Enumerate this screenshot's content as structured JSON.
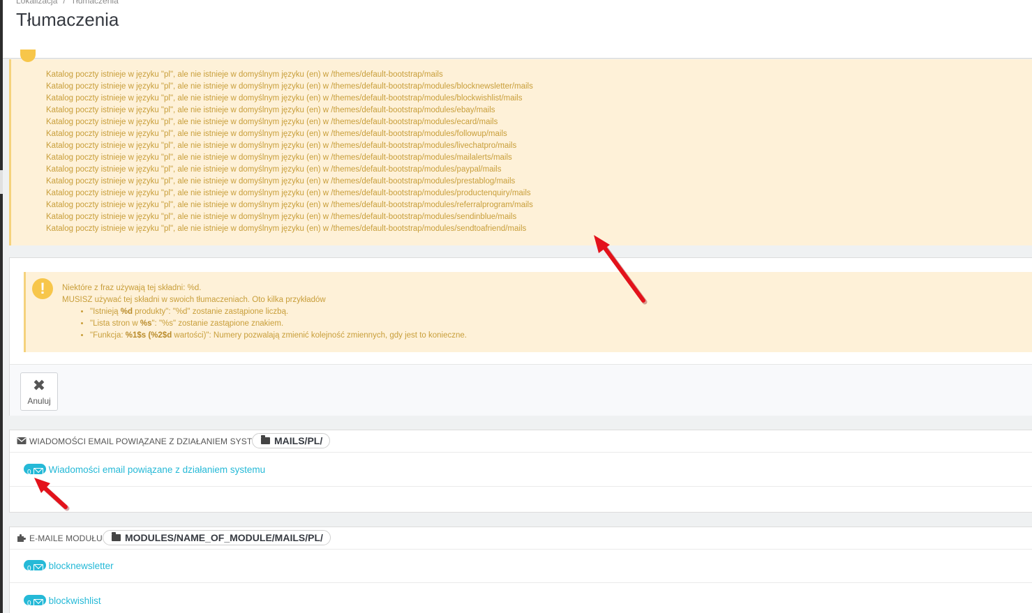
{
  "breadcrumb": {
    "parent": "Lokalizacja",
    "separator": "/",
    "current": "Tłumaczenia"
  },
  "page_title": "Tłumaczenia",
  "warnings": [
    "Katalog poczty istnieje w języku \"pl\", ale nie istnieje w domyślnym języku (en) w /themes/default-bootstrap/mails",
    "Katalog poczty istnieje w języku \"pl\", ale nie istnieje w domyślnym języku (en) w /themes/default-bootstrap/modules/blocknewsletter/mails",
    "Katalog poczty istnieje w języku \"pl\", ale nie istnieje w domyślnym języku (en) w /themes/default-bootstrap/modules/blockwishlist/mails",
    "Katalog poczty istnieje w języku \"pl\", ale nie istnieje w domyślnym języku (en) w /themes/default-bootstrap/modules/ebay/mails",
    "Katalog poczty istnieje w języku \"pl\", ale nie istnieje w domyślnym języku (en) w /themes/default-bootstrap/modules/ecard/mails",
    "Katalog poczty istnieje w języku \"pl\", ale nie istnieje w domyślnym języku (en) w /themes/default-bootstrap/modules/followup/mails",
    "Katalog poczty istnieje w języku \"pl\", ale nie istnieje w domyślnym języku (en) w /themes/default-bootstrap/modules/livechatpro/mails",
    "Katalog poczty istnieje w języku \"pl\", ale nie istnieje w domyślnym języku (en) w /themes/default-bootstrap/modules/mailalerts/mails",
    "Katalog poczty istnieje w języku \"pl\", ale nie istnieje w domyślnym języku (en) w /themes/default-bootstrap/modules/paypal/mails",
    "Katalog poczty istnieje w języku \"pl\", ale nie istnieje w domyślnym języku (en) w /themes/default-bootstrap/modules/prestablog/mails",
    "Katalog poczty istnieje w języku \"pl\", ale nie istnieje w domyślnym języku (en) w /themes/default-bootstrap/modules/productenquiry/mails",
    "Katalog poczty istnieje w języku \"pl\", ale nie istnieje w domyślnym języku (en) w /themes/default-bootstrap/modules/referralprogram/mails",
    "Katalog poczty istnieje w języku \"pl\", ale nie istnieje w domyślnym języku (en) w /themes/default-bootstrap/modules/sendinblue/mails",
    "Katalog poczty istnieje w języku \"pl\", ale nie istnieje w domyślnym języku (en) w /themes/default-bootstrap/modules/sendtoafriend/mails"
  ],
  "info": {
    "line1": "Niektóre z fraz używają tej składni: %d.",
    "line2": "MUSISZ używać tej składni w swoich tłumaczeniach. Oto kilka przykładów",
    "ex1_pre": "\"Istnieją ",
    "ex1_b": "%d",
    "ex1_post": " produkty\": \"%d\" zostanie zastąpione liczbą.",
    "ex2_pre": "\"Lista stron w ",
    "ex2_b": "%s",
    "ex2_post": "\": \"%s\" zostanie zastąpione znakiem.",
    "ex3_pre": "\"Funkcja: ",
    "ex3_b": "%1$s (%2$d",
    "ex3_post": " wartości)\": Numery pozwalają zmienić kolejność zmiennych, gdy jest to konieczne."
  },
  "cancel_button": {
    "label": "Anuluj",
    "icon": "close-icon"
  },
  "system_emails": {
    "heading": "WIADOMOŚCI EMAIL POWIĄZANE Z DZIAŁANIEM SYSTEMU",
    "path": "MAILS/PL/",
    "icon": "envelope-icon",
    "items": [
      {
        "count": "0",
        "label": "Wiadomości email powiązane z działaniem systemu"
      }
    ]
  },
  "module_emails": {
    "heading": "E-MAILE MODUŁU",
    "path": "MODULES/NAME_OF_MODULE/MAILS/PL/",
    "icon": "puzzle-icon",
    "items": [
      {
        "count": "0",
        "label": "blocknewsletter"
      },
      {
        "count": "0",
        "label": "blockwishlist"
      }
    ]
  },
  "colors": {
    "warning_bg": "#fef1d8",
    "warning_text": "#c89e3a",
    "link": "#25b9d7",
    "arrow": "#e3121b"
  }
}
